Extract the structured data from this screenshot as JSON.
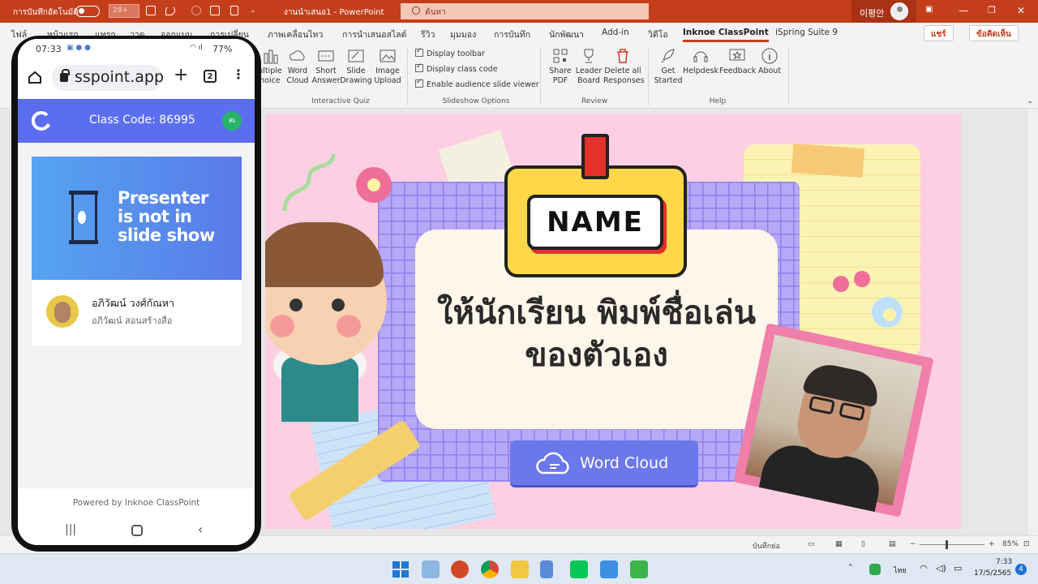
{
  "titlebar": {
    "autosave_label": "การบันทึกอัตโนมัติ",
    "zoom_value": "28+",
    "doc_title": "งานนำเสนอ1  -  PowerPoint",
    "search_placeholder": "ค้นหา",
    "user_name": "이평안"
  },
  "tabs": [
    "ไฟล์",
    "หน้าแรก",
    "แทรก",
    "วาด",
    "ออกแบบ",
    "การเปลี่ยน",
    "ภาพเคลื่อนไหว",
    "การนำเสนอสไลด์",
    "รีวิว",
    "มุมมอง",
    "การบันทึก",
    "นักพัฒนา",
    "Add-in",
    "วิดีโอ",
    "Inknoe ClassPoint",
    "iSpring Suite 9"
  ],
  "share_label": "แชร์",
  "comment_label": "ข้อคิดเห็น",
  "ribbon": {
    "interactive_quiz": {
      "label": "Interactive Quiz",
      "buttons": [
        {
          "line1": "ultiple",
          "line2": "hoice"
        },
        {
          "line1": "Word",
          "line2": "Cloud"
        },
        {
          "line1": "Short",
          "line2": "Answer"
        },
        {
          "line1": "Slide",
          "line2": "Drawing"
        },
        {
          "line1": "Image",
          "line2": "Upload"
        }
      ]
    },
    "slideshow_options": {
      "label": "Slideshow Options",
      "checks": [
        "Display toolbar",
        "Display class code",
        "Enable audience slide viewer"
      ]
    },
    "review": {
      "label": "Review",
      "buttons": [
        {
          "line1": "Share",
          "line2": "PDF"
        },
        {
          "line1": "Leader",
          "line2": "Board"
        },
        {
          "line1": "Delete all",
          "line2": "Responses"
        }
      ]
    },
    "help": {
      "label": "Help",
      "buttons": [
        {
          "line1": "Get",
          "line2": "Started"
        },
        {
          "line1": "Helpdesk",
          "line2": ""
        },
        {
          "line1": "Feedback",
          "line2": ""
        },
        {
          "line1": "About",
          "line2": ""
        }
      ]
    }
  },
  "slide": {
    "badge_text": "NAME",
    "title_line1": "ให้นักเรียน พิมพ์ชื่อเล่น",
    "title_line2": "ของตัวเอง",
    "button_label": "Word Cloud"
  },
  "statusbar": {
    "notes_label": "บันทึกย่อ",
    "zoom": "85%"
  },
  "taskbar": {
    "lang": "ไทย",
    "time": "7:33",
    "date": "17/5/2565",
    "badge": "4"
  },
  "phone": {
    "status_time": "07:33",
    "battery": "77%",
    "url": "sspoint.app",
    "tab_count": "2",
    "class_code": "Class Code: 86995",
    "avatar_initials": "สเ",
    "banner_text": [
      "Presenter",
      "is not in",
      "slide show"
    ],
    "user_name": "อภิวัฒน์ วงศ์กัณหา",
    "user_subtitle": "อภิวัฒน์ สอนสร้างสื่อ",
    "footer": "Powered by Inknoe ClassPoint"
  },
  "colors": {
    "ppt_red": "#c43e1c",
    "classpoint_blue": "#5b6ef0",
    "slide_pink": "#fcd0e2",
    "grid_purple": "#b7a9f7",
    "badge_yellow": "#ffd84a"
  }
}
